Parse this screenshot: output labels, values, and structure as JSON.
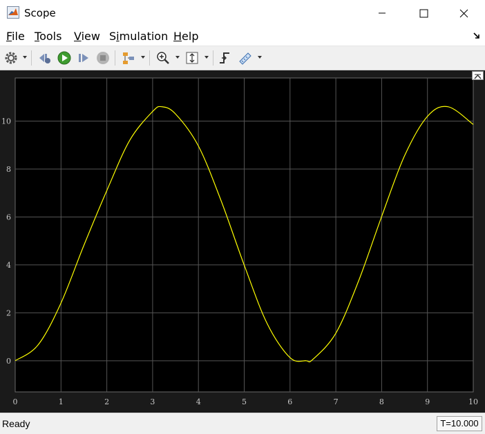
{
  "window": {
    "title": "Scope"
  },
  "menu": {
    "items": [
      {
        "pre": "",
        "u": "F",
        "post": "ile"
      },
      {
        "pre": "",
        "u": "T",
        "post": "ools"
      },
      {
        "pre": "",
        "u": "V",
        "post": "iew"
      },
      {
        "pre": "S",
        "u": "i",
        "post": "mulation"
      },
      {
        "pre": "",
        "u": "H",
        "post": "elp"
      }
    ]
  },
  "toolbar": {
    "icons": [
      "settings-icon",
      "step-back-icon",
      "run-icon",
      "step-forward-icon",
      "stop-icon",
      "signal-selector-icon",
      "zoom-in-icon",
      "autoscale-icon",
      "triggers-icon",
      "cursor-measurements-icon"
    ]
  },
  "colors": {
    "plot_bg": "#000000",
    "signal": "#ffff00",
    "grid": "#555555",
    "tick_text": "#c8c8c8"
  },
  "chart_data": {
    "type": "line",
    "title": "",
    "xlabel": "",
    "ylabel": "",
    "xlim": [
      0,
      10
    ],
    "ylim": [
      -1.3,
      11.8
    ],
    "xticks": [
      0,
      1,
      2,
      3,
      4,
      5,
      6,
      7,
      8,
      9,
      10
    ],
    "yticks": [
      0,
      2,
      4,
      6,
      8,
      10
    ],
    "grid": true,
    "series": [
      {
        "color": "#ffff00",
        "x": [
          0,
          0.5,
          1,
          1.5,
          2,
          2.5,
          3,
          3.2,
          3.5,
          4,
          4.5,
          5,
          5.5,
          6,
          6.35,
          6.5,
          7,
          7.5,
          8,
          8.5,
          9,
          9.45,
          10
        ],
        "y": [
          0,
          0.66,
          2.41,
          4.82,
          7.1,
          9.2,
          10.4,
          10.6,
          10.3,
          8.96,
          6.65,
          3.99,
          1.55,
          0.13,
          0,
          0.06,
          1.15,
          3.35,
          6.02,
          8.55,
          10.2,
          10.6,
          9.86
        ]
      }
    ]
  },
  "status": {
    "text": "Ready",
    "time": "T=10.000"
  }
}
